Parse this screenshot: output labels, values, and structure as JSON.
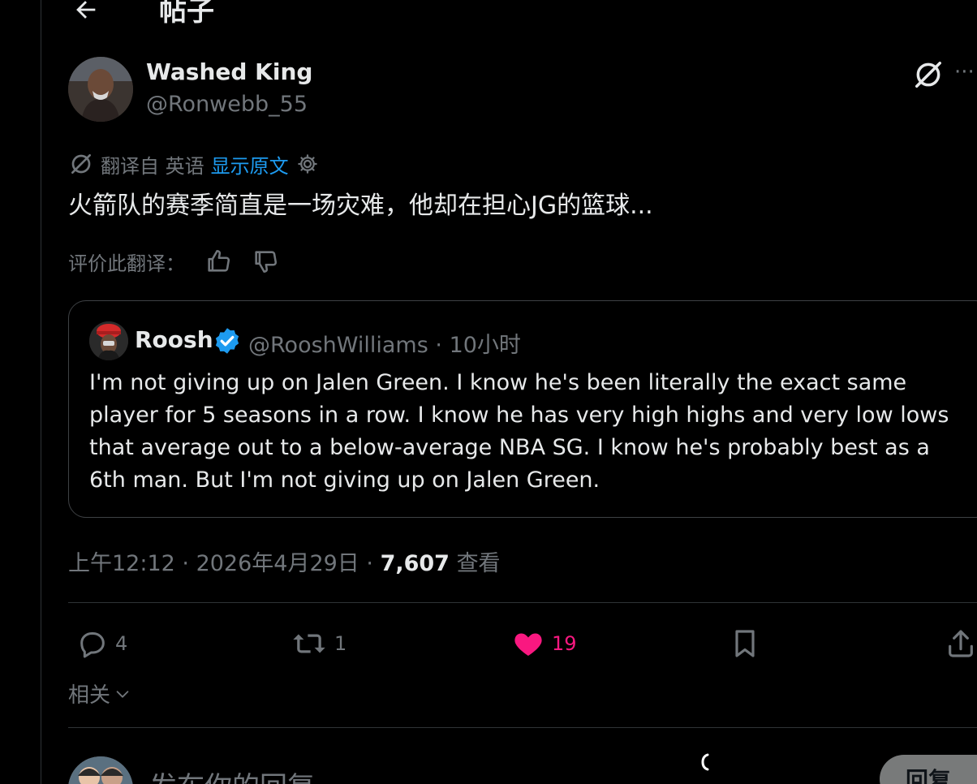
{
  "header": {
    "title": "帖子",
    "back_icon": "arrow-left-icon"
  },
  "post": {
    "author": {
      "display_name": "Washed King",
      "handle": "@Ronwebb_55"
    },
    "translation": {
      "prefix": "翻译自 英语",
      "show_original": "显示原文",
      "text": "火箭队的赛季简直是一场灾难，他却在担心JG的篮球...",
      "rate_label": "评价此翻译："
    },
    "quote": {
      "display_name": "Roosh",
      "handle": "@RooshWilliams",
      "time": "10小时",
      "text": "I'm not giving up on Jalen Green. I know he's been literally the exact same player for 5 seasons in a row. I know he has very high highs and very low lows that average out to a below-average NBA SG. I know he's probably best as a 6th man. But I'm not giving up on Jalen Green."
    },
    "meta": {
      "time": "上午12:12",
      "date": "2026年4月29日",
      "views": "7,607",
      "views_label": "查看"
    },
    "actions": {
      "replies": "4",
      "reposts": "1",
      "likes": "19"
    },
    "related_label": "相关"
  },
  "reply_composer": {
    "placeholder": "发布你的回复",
    "button_label": "回复"
  },
  "colors": {
    "background": "#000000",
    "text": "#e7e9ea",
    "muted": "#71767b",
    "link": "#1d9bf0",
    "like": "#f91880",
    "border": "#2f3336"
  }
}
